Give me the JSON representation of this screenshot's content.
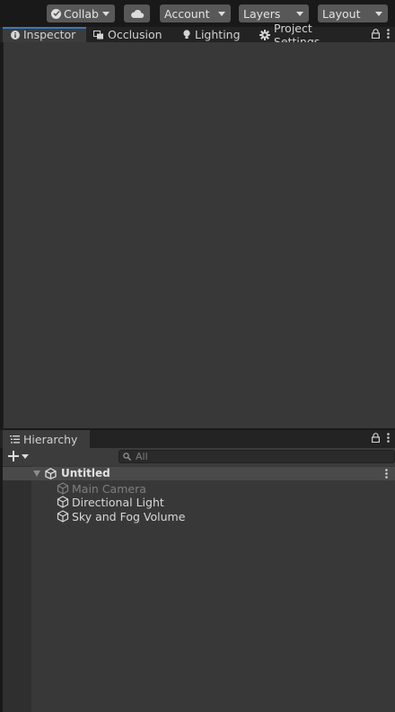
{
  "toolbar": {
    "collab_label": "Collab",
    "account_label": "Account",
    "layers_label": "Layers",
    "layout_label": "Layout"
  },
  "top_tabs": [
    {
      "label": "Inspector",
      "icon": "info-icon",
      "active": true
    },
    {
      "label": "Occlusion",
      "icon": "occlusion-icon",
      "active": false
    },
    {
      "label": "Lighting",
      "icon": "bulb-icon",
      "active": false
    },
    {
      "label": "Project Settings",
      "icon": "gear-icon",
      "active": false
    }
  ],
  "hierarchy": {
    "tab_label": "Hierarchy",
    "search_placeholder": "All",
    "scene_name": "Untitled",
    "items": [
      {
        "label": "Main Camera",
        "disabled": true
      },
      {
        "label": "Directional Light",
        "disabled": false
      },
      {
        "label": "Sky and Fog Volume",
        "disabled": false
      }
    ]
  },
  "colors": {
    "accent": "#3a79bb",
    "panel": "#383838",
    "background": "#191919"
  }
}
